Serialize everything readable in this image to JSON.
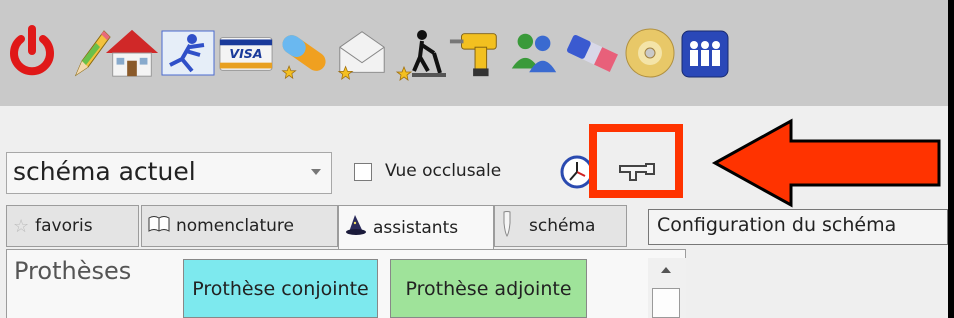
{
  "toolbar": {
    "icons": [
      {
        "name": "power-icon"
      },
      {
        "name": "pencil-icon"
      },
      {
        "name": "home-icon"
      },
      {
        "name": "runner-icon"
      },
      {
        "name": "visa-card-icon"
      },
      {
        "name": "pill-icon"
      },
      {
        "name": "envelope-icon"
      },
      {
        "name": "worker-shovel-icon"
      },
      {
        "name": "drill-icon"
      },
      {
        "name": "users-icon"
      },
      {
        "name": "eraser-icon"
      },
      {
        "name": "cd-icon"
      },
      {
        "name": "group-icon"
      }
    ],
    "visa_text": "VISA"
  },
  "schema_select": {
    "value": "schéma actuel"
  },
  "occlusal": {
    "label": "Vue occlusale"
  },
  "tabs": [
    {
      "label": "favoris",
      "icon": "star-icon"
    },
    {
      "label": "nomenclature",
      "icon": "book-icon"
    },
    {
      "label": "assistants",
      "icon": "wizard-icon"
    },
    {
      "label": "schéma",
      "icon": "tooth-icon"
    }
  ],
  "tooltip": "Configuration du schéma",
  "section_title": "Prothèses",
  "buttons": {
    "conjointe": "Prothèse conjointe",
    "adjointe": "Prothèse adjointe"
  },
  "colors": {
    "highlight": "#ff3300",
    "btn_conjointe": "#7de9ee",
    "btn_adjointe": "#9fe39a"
  }
}
